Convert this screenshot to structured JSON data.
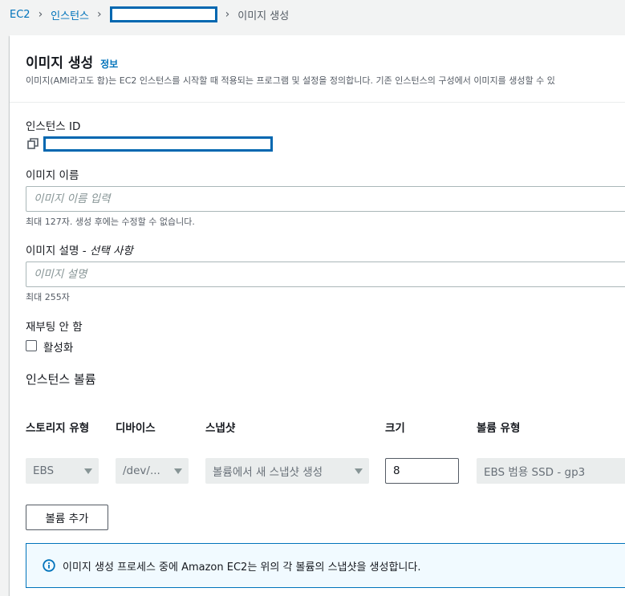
{
  "breadcrumb": {
    "root": "EC2",
    "instances": "인스턴스",
    "current": "이미지 생성"
  },
  "header": {
    "title": "이미지 생성",
    "info": "정보",
    "description": "이미지(AMI라고도 함)는 EC2 인스턴스를 시작할 때 적용되는 프로그램 및 설정을 정의합니다. 기존 인스턴스의 구성에서 이미지를 생성할 수 있"
  },
  "form": {
    "instance_id_label": "인스턴스 ID",
    "image_name_label": "이미지 이름",
    "image_name_placeholder": "이미지 이름 입력",
    "image_name_hint": "최대 127자. 생성 후에는 수정할 수 없습니다.",
    "image_desc_label": "이미지 설명",
    "image_desc_separator": " - ",
    "image_desc_optional": "선택 사항",
    "image_desc_placeholder": "이미지 설명",
    "image_desc_hint": "최대 255자",
    "no_reboot_label": "재부팅 안 함",
    "no_reboot_checkbox_label": "활성화",
    "no_reboot_checked": false
  },
  "volumes": {
    "section_title": "인스턴스 볼륨",
    "columns": {
      "storage_type": "스토리지 유형",
      "device": "디바이스",
      "snapshot": "스냅샷",
      "size": "크기",
      "volume_type": "볼륨 유형"
    },
    "row": {
      "storage_type": "EBS",
      "device": "/dev/...",
      "snapshot": "볼륨에서 새 스냅샷 생성",
      "size": "8",
      "volume_type": "EBS 범용 SSD - gp3"
    },
    "add_button": "볼륨 추가"
  },
  "alert": {
    "text": "이미지 생성 프로세스 중에 Amazon EC2는 위의 각 볼륨의 스냅샷을 생성합니다."
  },
  "colors": {
    "link": "#0073bb",
    "redaction_border": "#0067b0",
    "info_background": "#f1faff"
  }
}
